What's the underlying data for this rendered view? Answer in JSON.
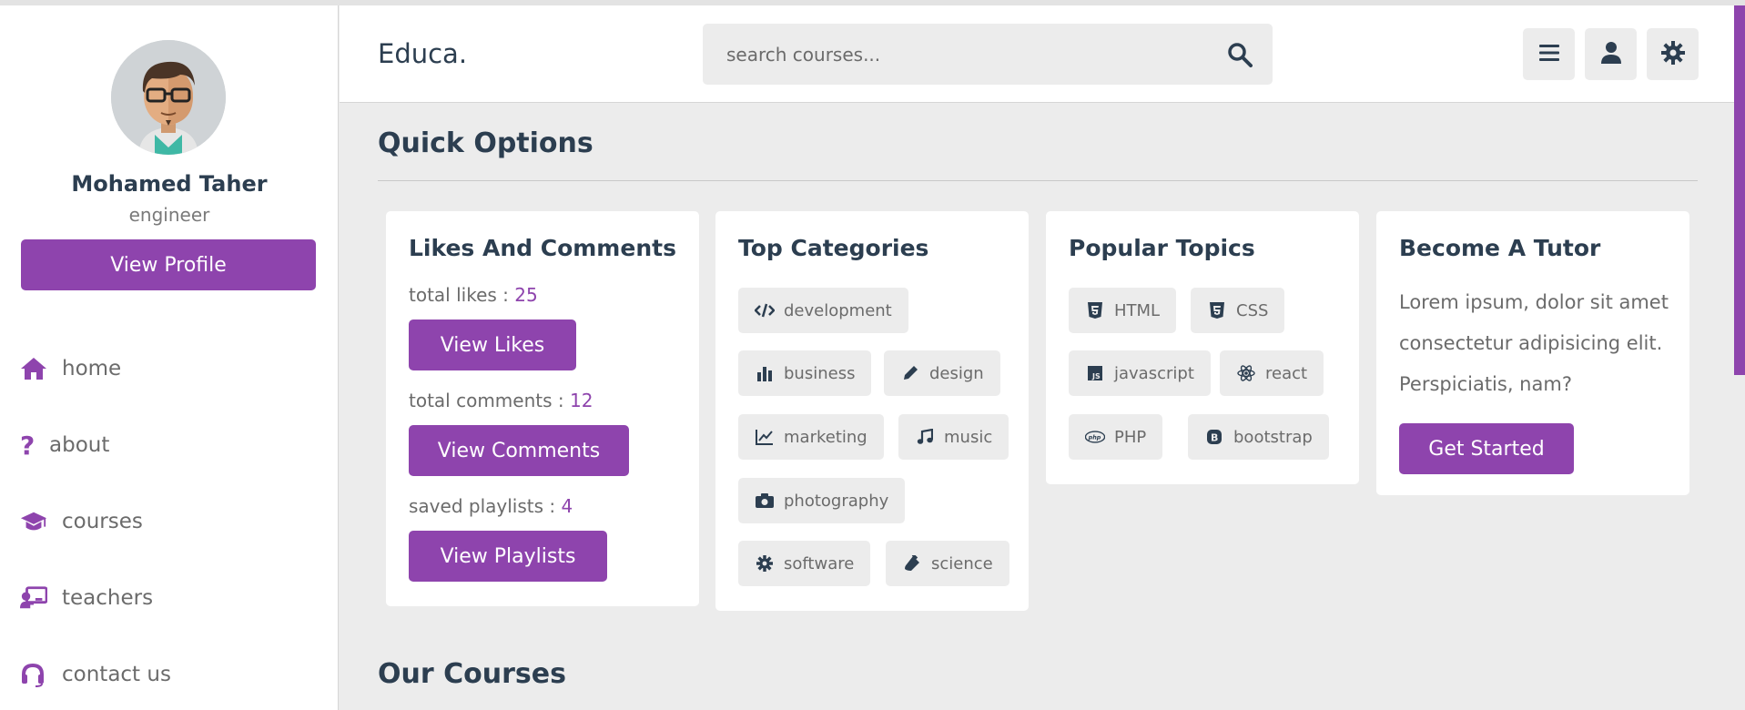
{
  "app": {
    "logo": "Educa."
  },
  "search": {
    "placeholder": "search courses..."
  },
  "profile": {
    "name": "Mohamed Taher",
    "role": "engineer",
    "button": "View Profile"
  },
  "nav": [
    {
      "label": "home",
      "icon": "home-icon"
    },
    {
      "label": "about",
      "icon": "question-icon"
    },
    {
      "label": "courses",
      "icon": "graduation-cap-icon"
    },
    {
      "label": "teachers",
      "icon": "teacher-icon"
    },
    {
      "label": "contact us",
      "icon": "headset-icon"
    }
  ],
  "quick_options": {
    "title": "Quick Options",
    "likes": {
      "title": "Likes And Comments",
      "likes_label": "total likes : ",
      "likes_count": "25",
      "likes_button": "View Likes",
      "comments_label": "total comments : ",
      "comments_count": "12",
      "comments_button": "View Comments",
      "playlists_label": "saved playlists : ",
      "playlists_count": "4",
      "playlists_button": "View Playlists"
    },
    "categories": {
      "title": "Top Categories",
      "items": [
        "development",
        "business",
        "design",
        "marketing",
        "music",
        "photography",
        "software",
        "science"
      ]
    },
    "topics": {
      "title": "Popular Topics",
      "items": [
        "HTML",
        "CSS",
        "javascript",
        "react",
        "PHP",
        "bootstrap"
      ]
    },
    "tutor": {
      "title": "Become A Tutor",
      "text": "Lorem ipsum, dolor sit amet consectetur adipisicing elit. Perspiciatis, nam?",
      "button": "Get Started"
    }
  },
  "courses": {
    "title": "Our Courses"
  },
  "colors": {
    "accent": "#8e44ad",
    "text": "#2c3e50",
    "background": "#ececec"
  }
}
